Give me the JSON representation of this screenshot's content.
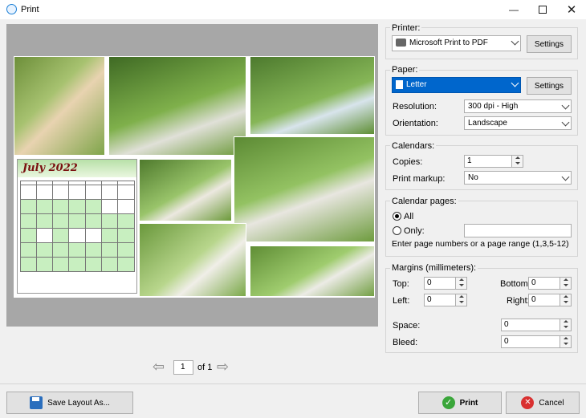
{
  "window": {
    "title": "Print"
  },
  "calendar_image": {
    "month_title": "July 2022"
  },
  "pager": {
    "page": "1",
    "of": "of 1"
  },
  "printer": {
    "group_label": "Printer:",
    "selected": "Microsoft Print to PDF",
    "settings": "Settings"
  },
  "paper": {
    "group_label": "Paper:",
    "selected": "Letter",
    "settings": "Settings",
    "resolution_label": "Resolution:",
    "resolution": "300 dpi - High",
    "orientation_label": "Orientation:",
    "orientation": "Landscape"
  },
  "calendars": {
    "group_label": "Calendars:",
    "copies_label": "Copies:",
    "copies": "1",
    "markup_label": "Print markup:",
    "markup": "No"
  },
  "calendar_pages": {
    "group_label": "Calendar pages:",
    "all_label": "All",
    "only_label": "Only:",
    "hint": "Enter page numbers or a page range (1,3,5-12)",
    "all_selected": true
  },
  "margins": {
    "group_label": "Margins (millimeters):",
    "top_label": "Top:",
    "top": "0",
    "bottom_label": "Bottom:",
    "bottom": "0",
    "left_label": "Left:",
    "left": "0",
    "right_label": "Right:",
    "right": "0",
    "space_label": "Space:",
    "space": "0",
    "bleed_label": "Bleed:",
    "bleed": "0"
  },
  "footer": {
    "save_layout": "Save Layout As...",
    "print": "Print",
    "cancel": "Cancel"
  },
  "colors": {
    "accent": "#0078d7",
    "selected_combo": "#0066cc"
  }
}
